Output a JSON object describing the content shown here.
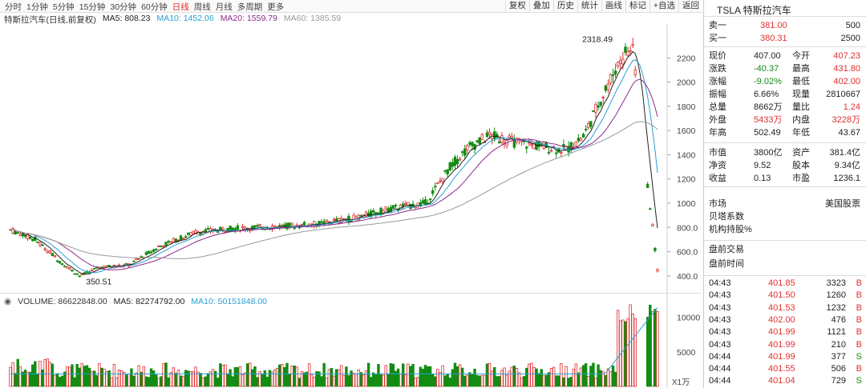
{
  "periods": [
    "分时",
    "1分钟",
    "5分钟",
    "15分钟",
    "30分钟",
    "60分钟",
    "日线",
    "周线",
    "月线",
    "多周期",
    "更多"
  ],
  "active_period": "日线",
  "toolbar": [
    "复权",
    "叠加",
    "历史",
    "统计",
    "画线",
    "标记",
    "+自选",
    "返回"
  ],
  "legend": {
    "name": "特斯拉汽车(日线,前复权)",
    "ma5": "MA5: 808.23",
    "ma10": "MA10: 1452.06",
    "ma20": "MA20: 1559.79",
    "ma60": "MA60: 1385.59"
  },
  "vol_legend": {
    "volume": "VOLUME: 86622848.00",
    "ma5": "MA5: 82274792.00",
    "ma10": "MA10: 50151848.00"
  },
  "colors": {
    "up": "#e03030",
    "down": "#128c12",
    "ma5": "#222222",
    "ma10": "#2a9fd6",
    "ma20": "#8b2a8b",
    "ma60": "#999999"
  },
  "chart_data": {
    "type": "candlestick",
    "price_axis": {
      "ticks": [
        400,
        600,
        800,
        1000,
        1200,
        1400,
        1600,
        1800,
        2000,
        2200
      ],
      "labels": [
        "400.0",
        "600.0",
        "800.0",
        "1000",
        "1200",
        "1400",
        "1600",
        "1800",
        "2000",
        "2200"
      ]
    },
    "annotations": {
      "high": "2318.49",
      "low": "350.51"
    },
    "volume_axis": {
      "ticks": [
        5000,
        10000
      ],
      "labels": [
        "5000",
        "10000"
      ],
      "unit": "X1万"
    }
  },
  "side": {
    "title": "TSLA 特斯拉汽车",
    "ask": {
      "label": "卖一",
      "price": "381.00",
      "vol": "500"
    },
    "bid": {
      "label": "买一",
      "price": "380.31",
      "vol": "2500"
    },
    "quote": [
      [
        "现价",
        "407.00",
        "今开",
        "407.23"
      ],
      [
        "涨跌",
        "-40.37",
        "最高",
        "431.80"
      ],
      [
        "涨幅",
        "-9.02%",
        "最低",
        "402.00"
      ],
      [
        "振幅",
        "6.66%",
        "现量",
        "2810667"
      ],
      [
        "总量",
        "8662万",
        "量比",
        "1.24"
      ],
      [
        "外盘",
        "5433万",
        "内盘",
        "3228万"
      ],
      [
        "年高",
        "502.49",
        "年低",
        "43.67"
      ]
    ],
    "fund": [
      [
        "市值",
        "3800亿",
        "资产",
        "381.4亿"
      ],
      [
        "净资",
        "9.52",
        "股本",
        "9.34亿"
      ],
      [
        "收益",
        "0.13",
        "市盈",
        "1236.1"
      ]
    ],
    "market_label": "市场",
    "market_value": "美国股票",
    "beta_label": "贝塔系数",
    "inst_label": "机构持股%",
    "pre_trade": "盘前交易",
    "pre_time": "盘前时间",
    "ticks": [
      [
        "04:43",
        "401.85",
        "3323",
        "B"
      ],
      [
        "04:43",
        "401.50",
        "1260",
        "B"
      ],
      [
        "04:43",
        "401.53",
        "1232",
        "B"
      ],
      [
        "04:43",
        "402.00",
        "476",
        "B"
      ],
      [
        "04:43",
        "401.99",
        "1121",
        "B"
      ],
      [
        "04:43",
        "401.99",
        "210",
        "B"
      ],
      [
        "04:44",
        "401.99",
        "377",
        "S"
      ],
      [
        "04:44",
        "401.55",
        "506",
        "B"
      ],
      [
        "04:44",
        "401.04",
        "729",
        "S"
      ]
    ]
  }
}
